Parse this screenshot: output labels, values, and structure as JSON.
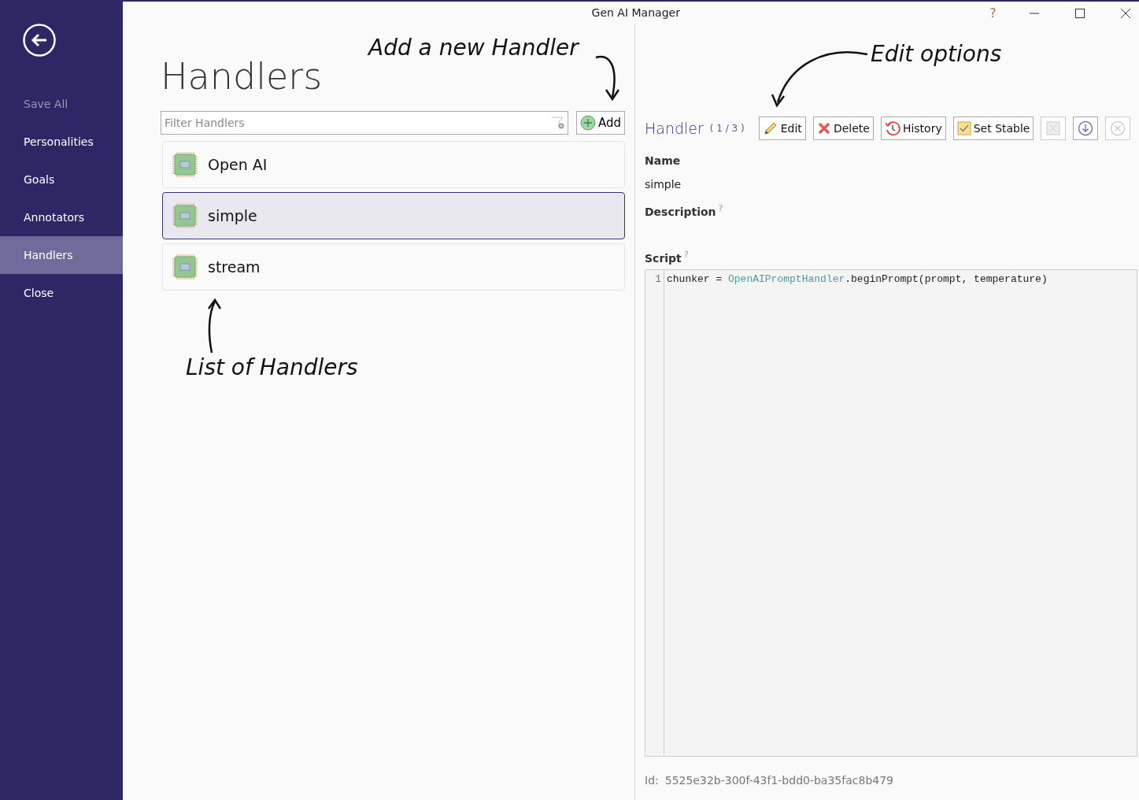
{
  "window": {
    "title": "Gen AI Manager",
    "help": "?"
  },
  "sidebar": {
    "items": [
      {
        "label": "Save All",
        "disabled": true,
        "selected": false
      },
      {
        "label": "Personalities",
        "disabled": false,
        "selected": false
      },
      {
        "label": "Goals",
        "disabled": false,
        "selected": false
      },
      {
        "label": "Annotators",
        "disabled": false,
        "selected": false
      },
      {
        "label": "Handlers",
        "disabled": false,
        "selected": true
      },
      {
        "label": "Close",
        "disabled": false,
        "selected": false
      }
    ]
  },
  "page_title": "Handlers",
  "filter": {
    "placeholder": "Filter Handlers"
  },
  "add_button": "Add",
  "handlers": [
    {
      "label": "Open AI",
      "selected": false
    },
    {
      "label": "simple",
      "selected": true
    },
    {
      "label": "stream",
      "selected": false
    }
  ],
  "detail": {
    "title": "Handler",
    "position": "( 1 / 3 )",
    "buttons": [
      {
        "kind": "edit",
        "label": "Edit",
        "disabled": false
      },
      {
        "kind": "delete",
        "label": "Delete",
        "disabled": false
      },
      {
        "kind": "history",
        "label": "History",
        "disabled": false
      },
      {
        "kind": "stable",
        "label": "Set Stable",
        "disabled": false
      },
      {
        "kind": "discard",
        "disabled": true
      },
      {
        "kind": "download",
        "disabled": false
      },
      {
        "kind": "cancel",
        "disabled": true
      }
    ],
    "fields": [
      {
        "label": "Name",
        "value": "simple"
      },
      {
        "label": "Description",
        "help": "?"
      },
      {
        "label": "Script",
        "help": "?"
      }
    ],
    "script_lines": [
      {
        "number": "1",
        "parts": [
          {
            "text": "chunker = ",
            "kind": "plain"
          },
          {
            "text": "OpenAIPromptHandler",
            "kind": "type"
          },
          {
            "text": ".beginPrompt(prompt, temperature)",
            "kind": "plain"
          }
        ]
      }
    ],
    "id_label": "Id:",
    "id_value": "5525e32b-300f-43f1-bdd0-ba35fac8b479"
  },
  "annotations": [
    {
      "kind": "add",
      "text": "Add a new Handler"
    },
    {
      "kind": "edit",
      "text": "Edit options"
    },
    {
      "kind": "list",
      "text": "List of Handlers"
    }
  ]
}
